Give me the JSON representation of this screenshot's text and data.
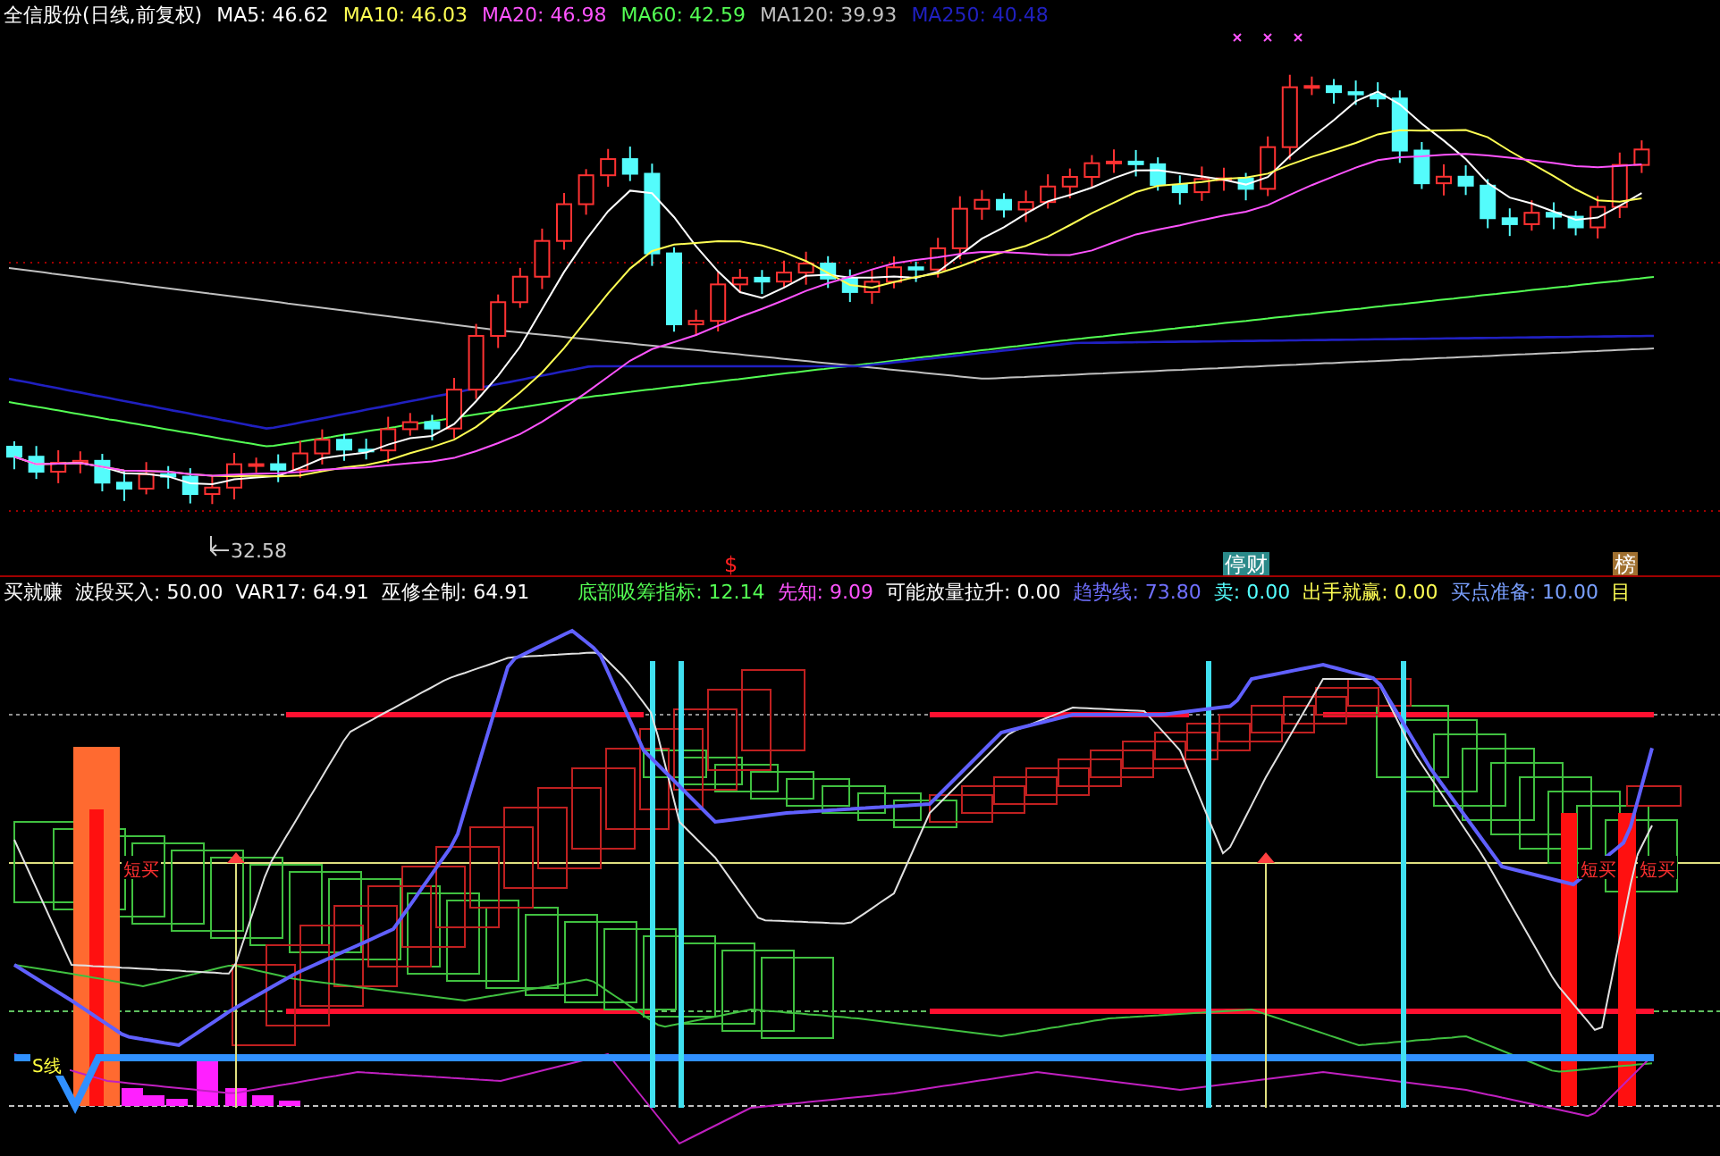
{
  "price_panel": {
    "title": "全信股份(日线,前复权)",
    "legend": [
      {
        "text": "MA5: 46.62",
        "color": "#ffffff"
      },
      {
        "text": "MA10: 46.03",
        "color": "#ffff54"
      },
      {
        "text": "MA20: 46.98",
        "color": "#ff54ff"
      },
      {
        "text": "MA60: 42.59",
        "color": "#54ff54"
      },
      {
        "text": "MA120: 39.93",
        "color": "#c0c0c0"
      },
      {
        "text": "MA250: 40.48",
        "color": "#2020c0"
      }
    ],
    "low_label": "32.58",
    "signals": [
      {
        "text": "$",
        "kind": "mark"
      },
      {
        "text": "停财",
        "kind": "tag"
      },
      {
        "text": "榜",
        "kind": "tag"
      }
    ]
  },
  "indicator_panel": {
    "title": "买就赚",
    "legend": [
      {
        "text": "波段买入: 50.00",
        "color": "#ffffff"
      },
      {
        "text": "VAR17: 64.91",
        "color": "#ffffff"
      },
      {
        "text": "巫修全制: 64.91",
        "color": "#ffffff"
      },
      {
        "text": "底部吸筹指标: 12.14",
        "color": "#54ff54"
      },
      {
        "text": "先知: 9.09",
        "color": "#ff54ff"
      },
      {
        "text": "可能放量拉升: 0.00",
        "color": "#ffffff"
      },
      {
        "text": "趋势线: 73.80",
        "color": "#7070ff"
      },
      {
        "text": "卖: 0.00",
        "color": "#54ffff"
      },
      {
        "text": "出手就赢: 0.00",
        "color": "#ffff54"
      },
      {
        "text": "买点准备: 10.00",
        "color": "#7aa0ff"
      },
      {
        "text": "目",
        "color": "#ffff54"
      }
    ],
    "labels": [
      "短买",
      "S线",
      "短买",
      "短买"
    ]
  }
}
